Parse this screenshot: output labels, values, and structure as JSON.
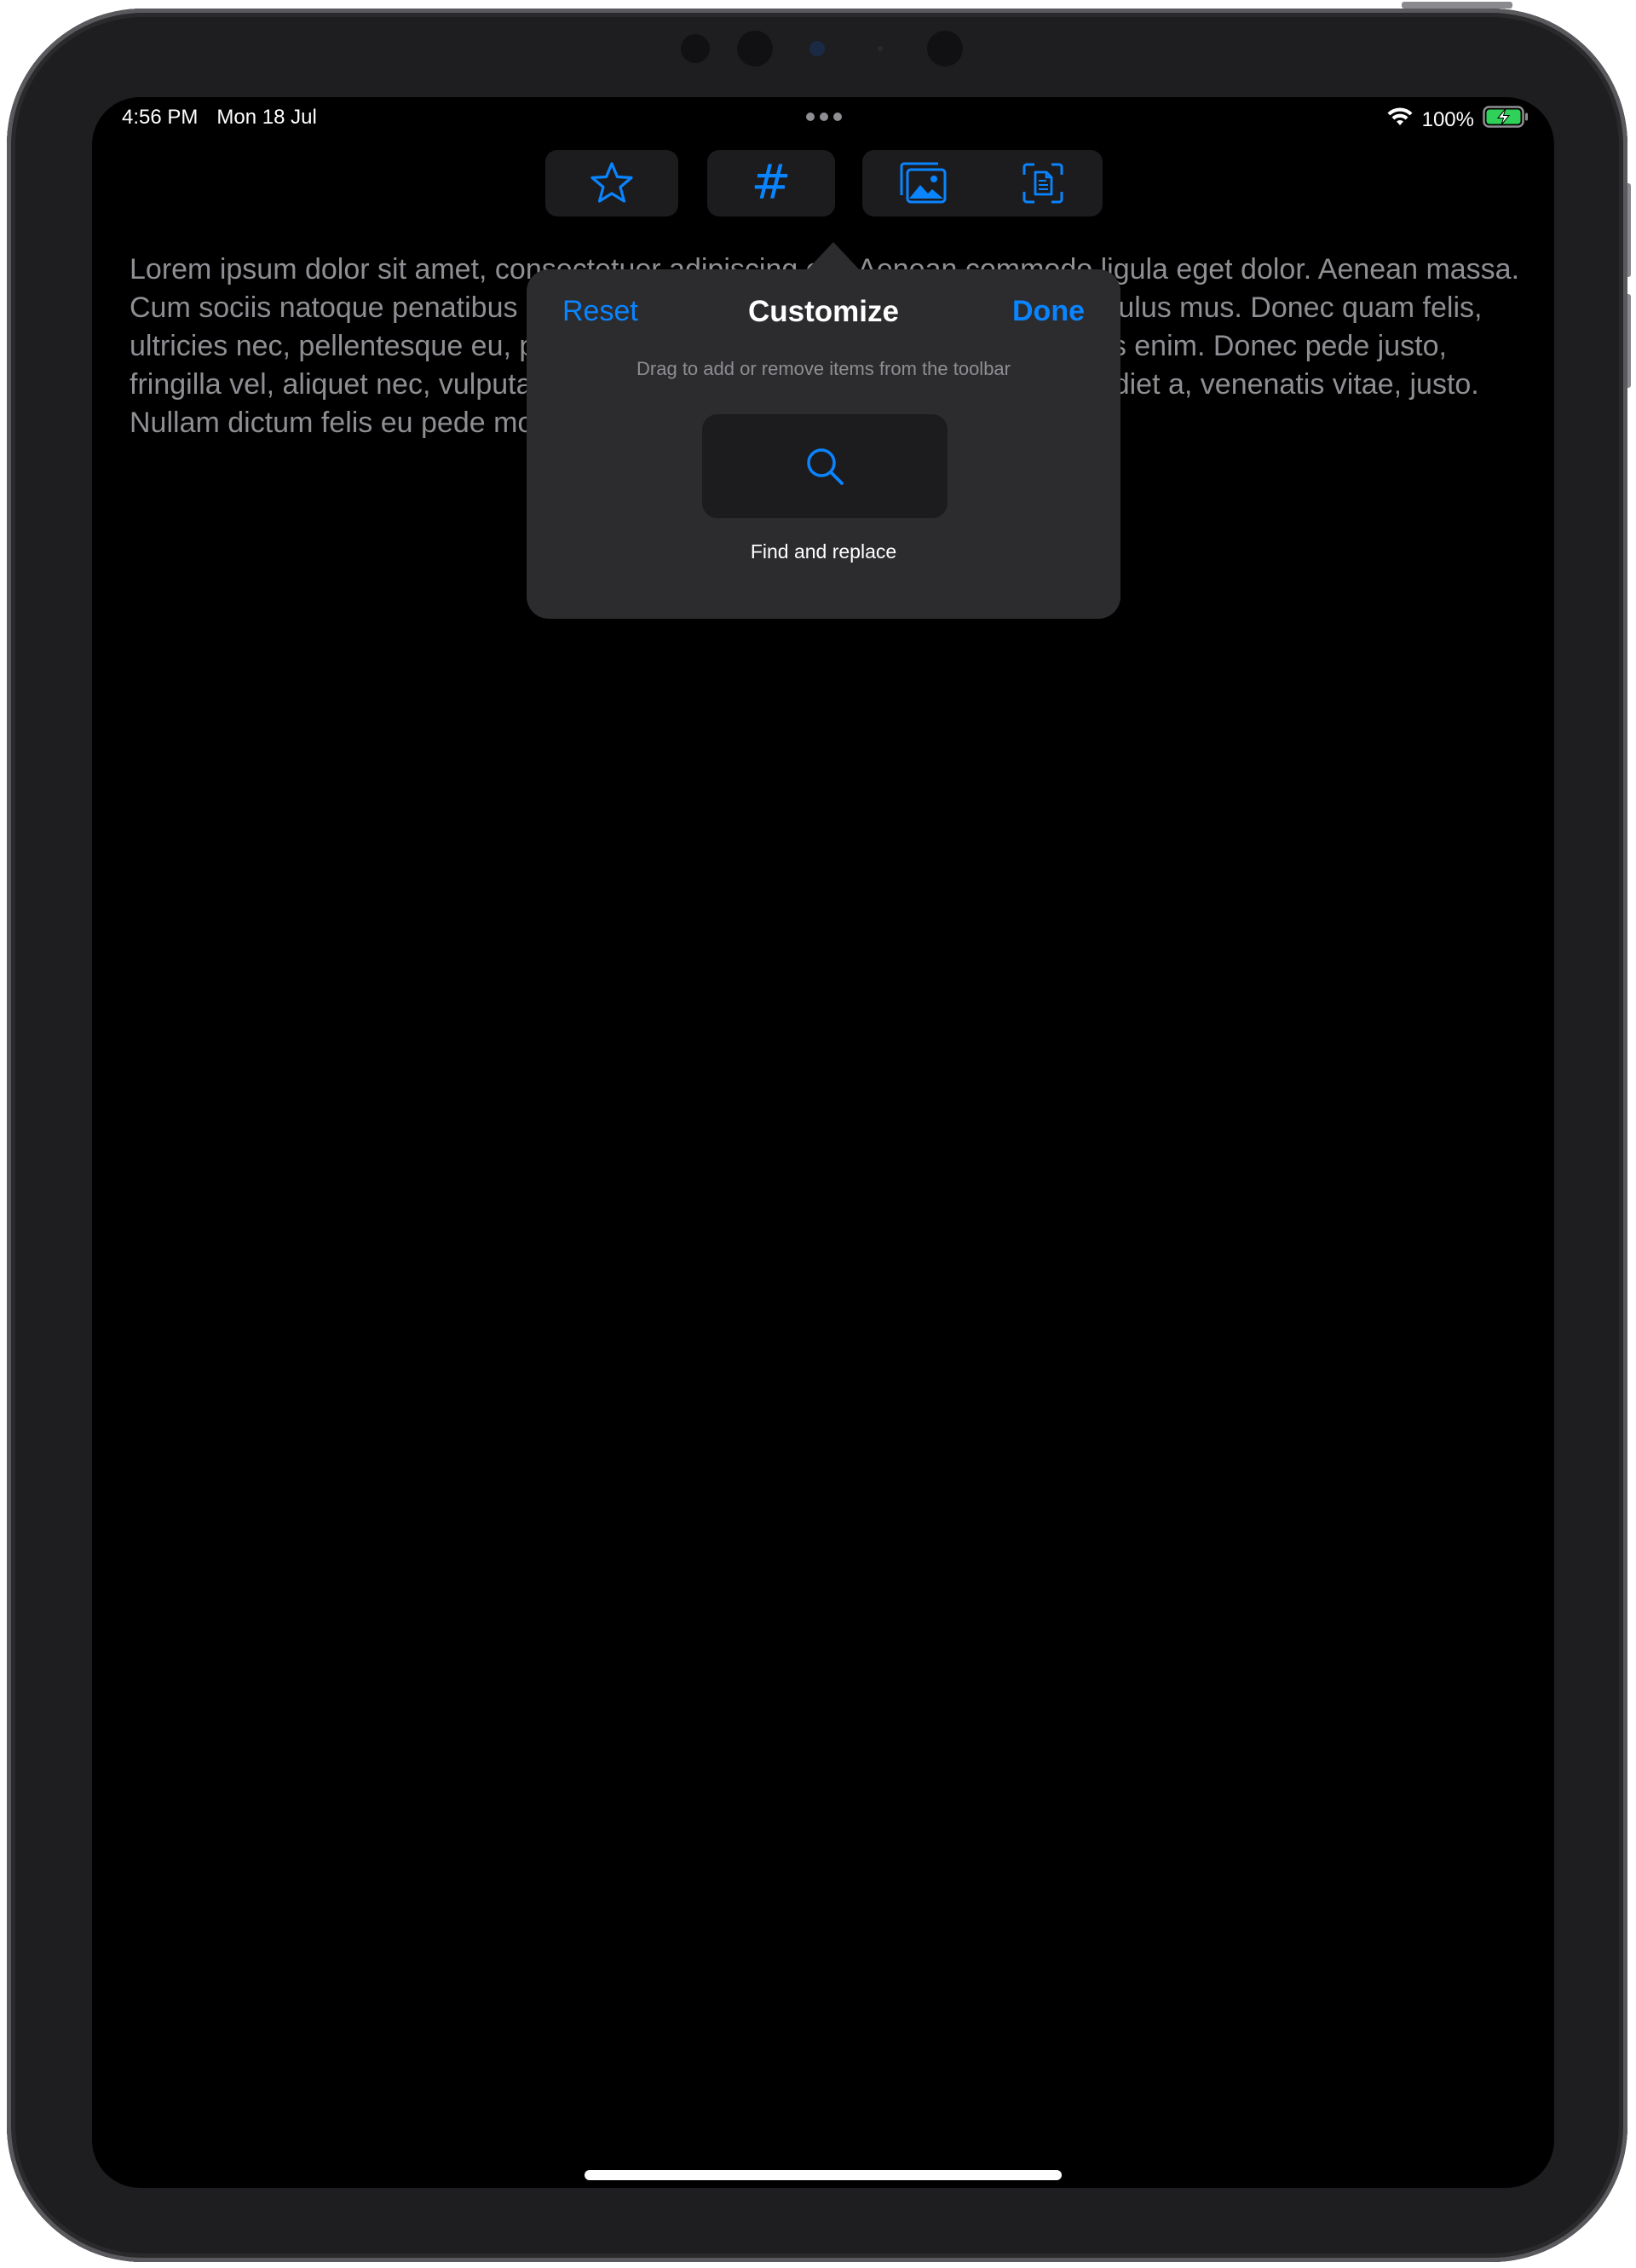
{
  "status_bar": {
    "time": "4:56 PM",
    "date": "Mon 18 Jul",
    "battery_percent": "100%"
  },
  "toolbar": {
    "items": [
      {
        "name": "favorite",
        "icon": "star-icon"
      },
      {
        "name": "tag",
        "icon": "hashtag-icon",
        "glyph": "#"
      },
      {
        "name": "insert-photo",
        "icon": "photo-library-icon"
      },
      {
        "name": "scan-document",
        "icon": "document-scan-icon"
      }
    ]
  },
  "note": {
    "body": "Lorem ipsum dolor sit amet, consectetuer adipiscing elit. Aenean commodo ligula eget dolor. Aenean massa. Cum sociis natoque penatibus et magnis dis parturient montes, nascetur ridiculus mus. Donec quam felis, ultricies nec, pellentesque eu, pretium quis, sem. Nulla consequat massa quis enim. Donec pede justo, fringilla vel, aliquet nec, vulputate eget, arcu. In enim justo, rhoncus ut, imperdiet a, venenatis vitae, justo. Nullam dictum felis eu pede mollis pretium."
  },
  "customize_popover": {
    "title": "Customize",
    "reset_label": "Reset",
    "done_label": "Done",
    "hint": "Drag to add or remove items from the toolbar",
    "available_items": [
      {
        "label": "Find and replace",
        "icon": "search-icon"
      }
    ]
  },
  "colors": {
    "accent": "#0a84ff",
    "background": "#000000",
    "popover": "#2c2c2e",
    "tile": "#1c1c1e",
    "secondary_text": "#8e8e93",
    "battery_fill": "#30d158"
  },
  "battery_level": 1.0
}
